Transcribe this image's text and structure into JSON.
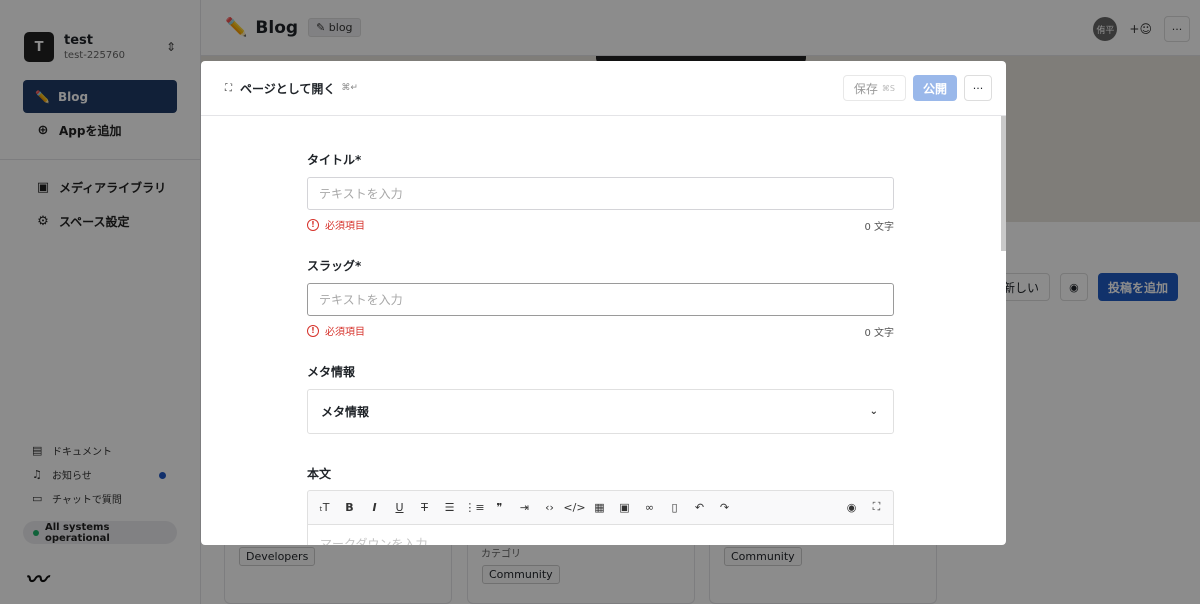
{
  "workspace": {
    "avatar_letter": "T",
    "name": "test",
    "id": "test-225760",
    "switch_icon": "⌃⌄"
  },
  "sidebar": {
    "active_item": {
      "icon": "pencil-icon",
      "label": "Blog"
    },
    "add_app": "Appを追加",
    "items": [
      {
        "icon": "image-icon",
        "label": "メディアライブラリ"
      },
      {
        "icon": "gear-icon",
        "label": "スペース設定"
      }
    ],
    "footer": {
      "docs": "ドキュメント",
      "notifications": "お知らせ",
      "chat": "チャットで質問",
      "status": "All systems operational"
    }
  },
  "topbar": {
    "title": "Blog",
    "badge": "blog",
    "avatar_text": "侑平"
  },
  "list_toolbar": {
    "sort_label": "新しい",
    "add_post": "投稿を追加"
  },
  "cards": [
    {
      "chip": "Developers"
    },
    {
      "label": "カテゴリ",
      "chip": "Community"
    },
    {
      "chip": "Community"
    }
  ],
  "modal": {
    "open_as_page": "ページとして開く",
    "open_kbd": "⌘↵",
    "save": "保存",
    "save_kbd": "⌘S",
    "publish": "公開",
    "more": "···",
    "fields": {
      "title": {
        "label": "タイトル*",
        "placeholder": "テキストを入力",
        "error": "必須項目",
        "count": "0 文字"
      },
      "slug": {
        "label": "スラッグ*",
        "placeholder": "テキストを入力",
        "error": "必須項目",
        "count": "0 文字"
      },
      "meta": {
        "label": "メタ情報",
        "box_label": "メタ情報"
      },
      "body": {
        "label": "本文",
        "placeholder": "マークダウンを入力"
      }
    }
  },
  "colors": {
    "primary": "#1f5cc4",
    "sidebar_active": "#1f3b66",
    "error": "#d6322b",
    "status_ok": "#1eb36a"
  }
}
